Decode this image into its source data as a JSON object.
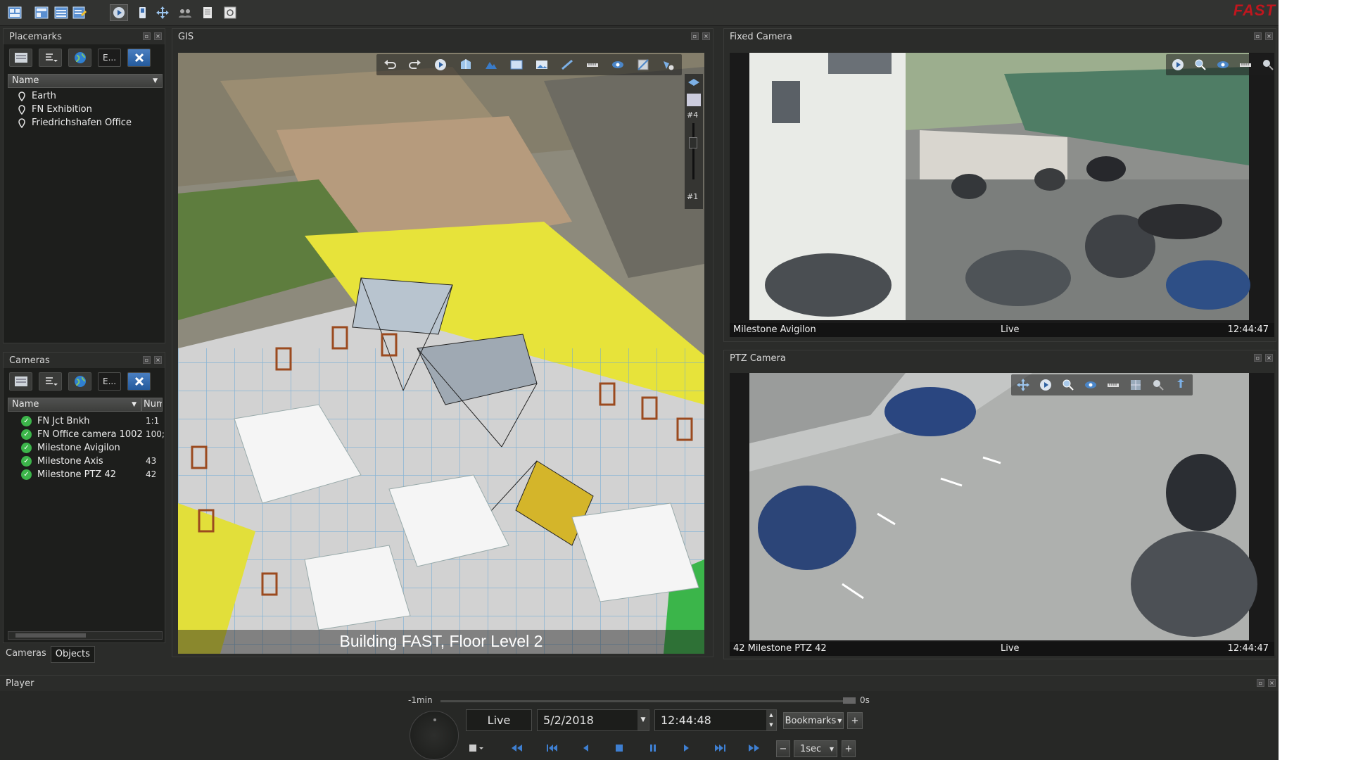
{
  "brand": {
    "logo_text": "FAST",
    "color": "#c0161e"
  },
  "main_toolbar": {
    "icons": [
      "layout-icon",
      "layout-add-icon",
      "layout-grid-icon",
      "layout-edit-icon",
      "play-icon",
      "phone-icon",
      "move-icon",
      "group-icon",
      "document-icon",
      "refresh-icon"
    ]
  },
  "placemarks": {
    "title": "Placemarks",
    "tools": {
      "filter_label": "E..."
    },
    "column_header": "Name",
    "items": [
      {
        "label": "Earth"
      },
      {
        "label": "FN Exhibition"
      },
      {
        "label": "Friedrichshafen Office"
      }
    ]
  },
  "cameras": {
    "title": "Cameras",
    "tools": {
      "filter_label": "E..."
    },
    "columns": {
      "name": "Name",
      "num": "Num"
    },
    "items": [
      {
        "name": "FN Jct Bnkh",
        "num": "1:1"
      },
      {
        "name": "FN Office camera 1002",
        "num": "100;"
      },
      {
        "name": "Milestone Avigilon",
        "num": ""
      },
      {
        "name": "Milestone Axis",
        "num": "43"
      },
      {
        "name": "Milestone PTZ 42",
        "num": "42"
      }
    ]
  },
  "left_tabs": [
    {
      "label": "Cameras"
    },
    {
      "label": "Objects"
    }
  ],
  "gis": {
    "title": "GIS",
    "caption": "Building FAST, Floor Level 2",
    "floor_top": "#4",
    "floor_bottom": "#1"
  },
  "fixed_camera": {
    "title": "Fixed Camera",
    "name": "Milestone Avigilon",
    "status": "Live",
    "time": "12:44:47"
  },
  "ptz_camera": {
    "title": "PTZ Camera",
    "name": "42 Milestone PTZ 42",
    "status": "Live",
    "time": "12:44:47"
  },
  "player": {
    "title": "Player",
    "timeline_start": "-1min",
    "timeline_end": "0s",
    "mode": "Live",
    "date": "5/2/2018",
    "time": "12:44:48",
    "bookmarks_label": "Bookmarks",
    "speed": "1sec"
  }
}
